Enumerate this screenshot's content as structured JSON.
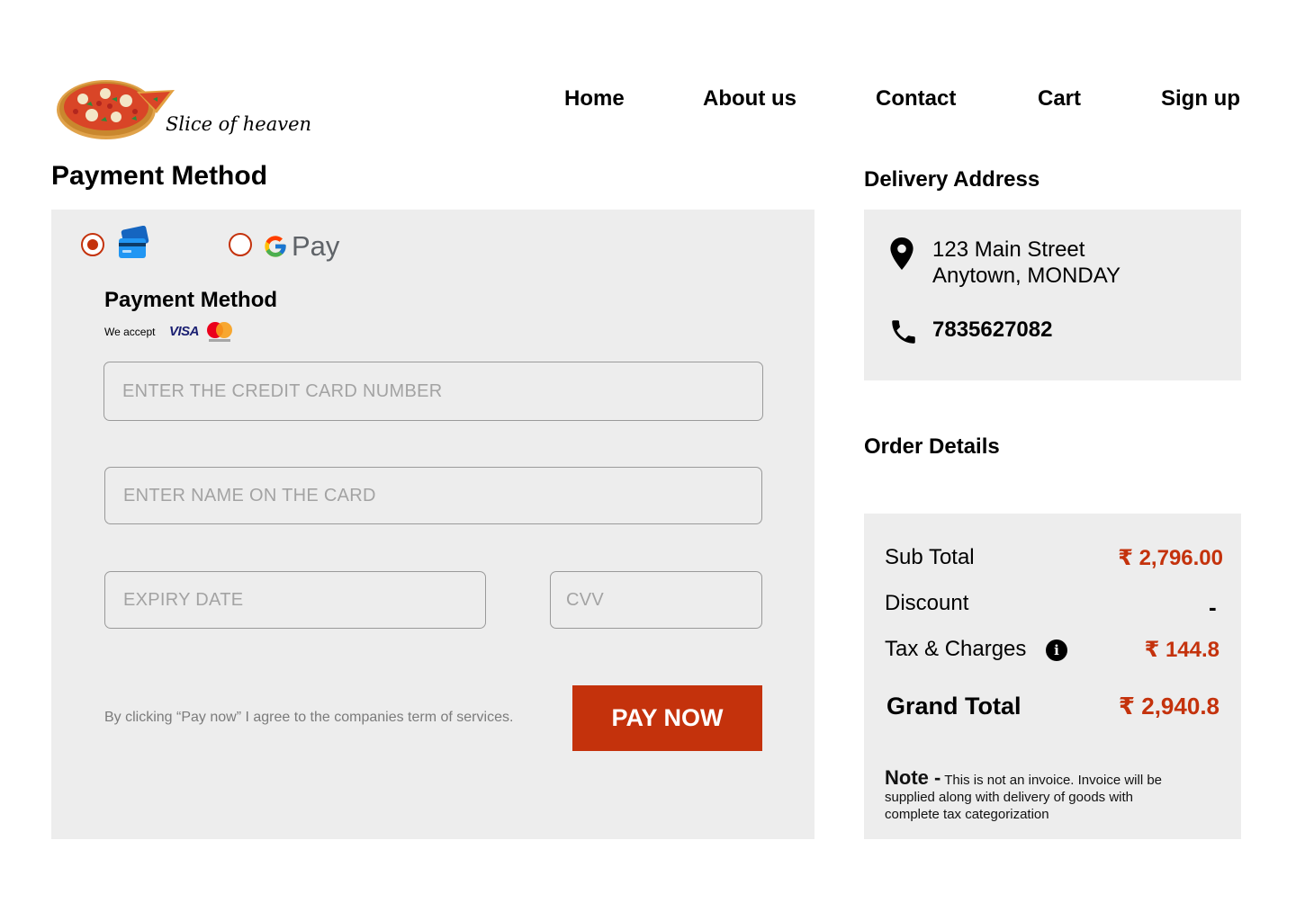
{
  "brand": {
    "name": "Slice of heaven",
    "logo_icon": "pizza-icon"
  },
  "nav": {
    "home": "Home",
    "about": "About us",
    "contact": "Contact",
    "cart": "Cart",
    "signup": "Sign up"
  },
  "payment": {
    "title": "Payment Method",
    "options": [
      {
        "name": "credit-card",
        "icon": "credit-card-icon",
        "selected": true
      },
      {
        "name": "gpay",
        "icon": "google-g-icon",
        "label": "Pay",
        "selected": false
      }
    ],
    "card_form": {
      "title": "Payment Method",
      "we_accept": "We accept",
      "visa_label": "VISA",
      "card_number_placeholder": "ENTER THE CREDIT CARD NUMBER",
      "card_name_placeholder": "ENTER NAME ON THE CARD",
      "expiry_placeholder": "EXPIRY DATE",
      "cvv_placeholder": "CVV"
    },
    "terms": "By clicking “Pay now” I agree to the companies term of services.",
    "pay_button": "PAY NOW"
  },
  "delivery": {
    "title": "Delivery Address",
    "address_line1": "123 Main Street",
    "address_line2": "Anytown, MONDAY",
    "phone": "7835627082"
  },
  "order": {
    "title": "Order Details",
    "currency_symbol": "₹",
    "subtotal_label": "Sub Total",
    "subtotal_value": "2,796.00",
    "discount_label": "Discount",
    "discount_value": "-",
    "tax_label": "Tax & Charges",
    "tax_value": "144.8",
    "grand_total_label": "Grand Total",
    "grand_total_value": "2,940.8",
    "note_label": "Note -",
    "note_text": "This is not an invoice. Invoice will be supplied along with delivery of goods with complete tax categorization"
  },
  "colors": {
    "accent": "#c4320c",
    "panel": "#ededed",
    "placeholder": "#a3a3a3"
  }
}
